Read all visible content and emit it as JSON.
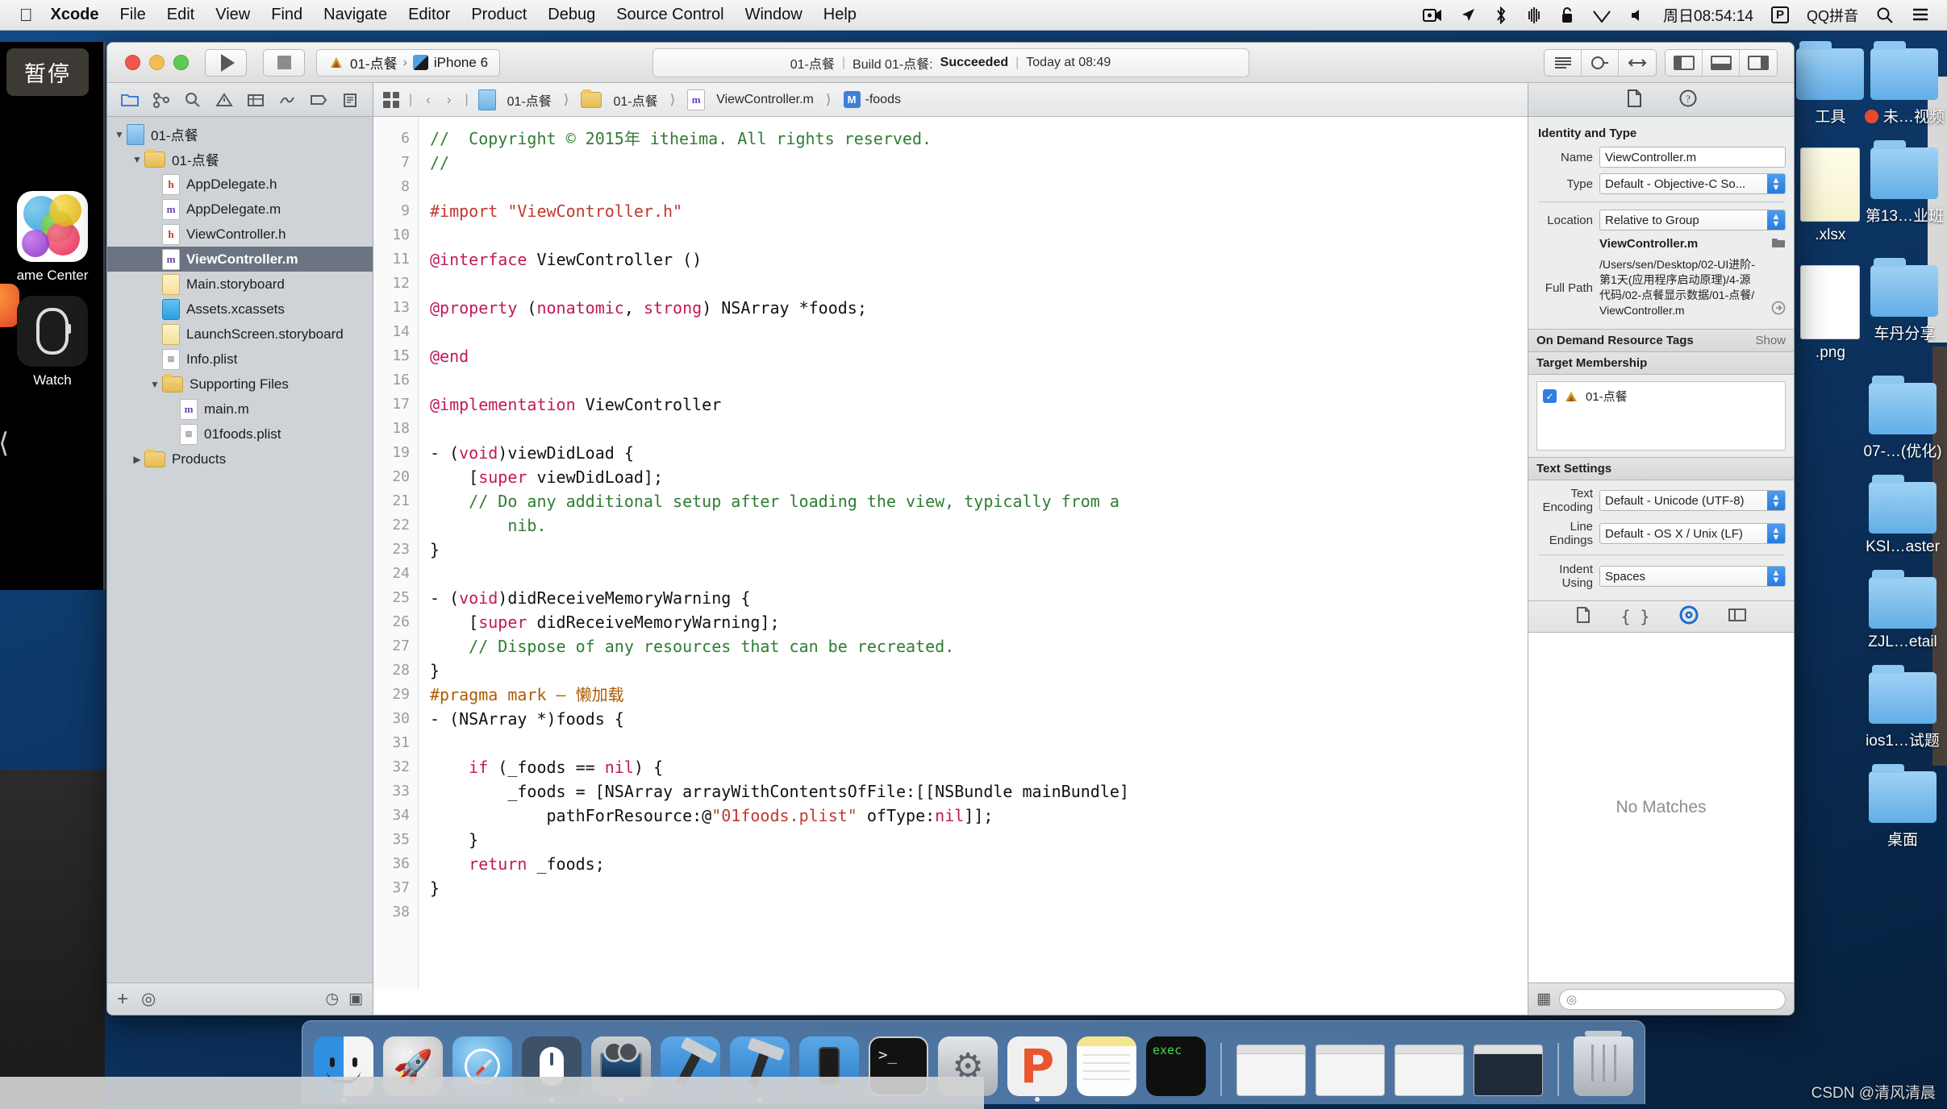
{
  "menubar": {
    "apple_icon": "apple-logo-icon",
    "items": [
      "Xcode",
      "File",
      "Edit",
      "View",
      "Find",
      "Navigate",
      "Editor",
      "Product",
      "Debug",
      "Source Control",
      "Window",
      "Help"
    ],
    "status_icons": [
      "screen-record-icon",
      "location-arrow-icon",
      "bluetooth-icon",
      "airdrop-icon",
      "lock-icon",
      "wifi-icon",
      "volume-icon"
    ],
    "clock": "周日08:54:14",
    "input_method_badge": "P",
    "input_method": "QQ拼音",
    "search_icon": "search-icon",
    "notification_icon": "notification-list-icon"
  },
  "tooltip": {
    "pause_label": "暂停"
  },
  "simulator": {
    "apps": [
      {
        "label": "ame Center",
        "icon": "game-center-icon"
      },
      {
        "label": "Watch",
        "icon": "watch-app-icon"
      }
    ]
  },
  "xcode": {
    "toolbar": {
      "run_icon": "run-play-icon",
      "stop_icon": "stop-square-icon",
      "scheme_target": "01-点餐",
      "scheme_chevron": "›",
      "scheme_device": "iPhone 6",
      "status": {
        "project": "01-点餐",
        "sep": "|",
        "build_text": "Build 01-点餐:",
        "result": "Succeeded",
        "time": "Today at 08:49"
      },
      "right_buttons": [
        "editor-standard-icon",
        "editor-assistant-icon",
        "editor-version-icon",
        "view-left-panel-icon",
        "view-bottom-panel-icon",
        "view-right-panel-icon"
      ]
    },
    "navigator": {
      "toolbar_icons": [
        "folder-navigator-icon",
        "source-control-icon",
        "search-navigator-icon",
        "issue-navigator-icon",
        "test-navigator-icon",
        "debug-navigator-icon",
        "breakpoint-navigator-icon",
        "report-navigator-icon"
      ],
      "tree": [
        {
          "label": "01-点餐",
          "icon": "project-icon",
          "indent": 0,
          "twisty": "▼",
          "selected": false
        },
        {
          "label": "01-点餐",
          "icon": "folder-icon",
          "indent": 1,
          "twisty": "▼",
          "selected": false
        },
        {
          "label": "AppDelegate.h",
          "icon": "header-file-icon",
          "indent": 2,
          "twisty": "",
          "selected": false
        },
        {
          "label": "AppDelegate.m",
          "icon": "objc-file-icon",
          "indent": 2,
          "twisty": "",
          "selected": false
        },
        {
          "label": "ViewController.h",
          "icon": "header-file-icon",
          "indent": 2,
          "twisty": "",
          "selected": false
        },
        {
          "label": "ViewController.m",
          "icon": "objc-file-icon",
          "indent": 2,
          "twisty": "",
          "selected": true
        },
        {
          "label": "Main.storyboard",
          "icon": "storyboard-icon",
          "indent": 2,
          "twisty": "",
          "selected": false
        },
        {
          "label": "Assets.xcassets",
          "icon": "xcassets-icon",
          "indent": 2,
          "twisty": "",
          "selected": false
        },
        {
          "label": "LaunchScreen.storyboard",
          "icon": "storyboard-icon",
          "indent": 2,
          "twisty": "",
          "selected": false
        },
        {
          "label": "Info.plist",
          "icon": "plist-file-icon",
          "indent": 2,
          "twisty": "",
          "selected": false
        },
        {
          "label": "Supporting Files",
          "icon": "folder-icon",
          "indent": 2,
          "twisty": "▼",
          "selected": false
        },
        {
          "label": "main.m",
          "icon": "objc-file-icon",
          "indent": 3,
          "twisty": "",
          "selected": false
        },
        {
          "label": "01foods.plist",
          "icon": "plist-file-icon",
          "indent": 3,
          "twisty": "",
          "selected": false
        },
        {
          "label": "Products",
          "icon": "folder-icon",
          "indent": 1,
          "twisty": "▶",
          "selected": false
        }
      ],
      "footer": {
        "add_icon": "plus-icon",
        "filter_icon": "filter-circle-icon",
        "recent_icon": "clock-icon",
        "source_icon": "source-control-filter-icon"
      }
    },
    "jumpbar": {
      "grid_icon": "related-items-icon",
      "back_icon": "‹",
      "forward_icon": "›",
      "crumbs": [
        {
          "label": "01-点餐",
          "icon": "project-icon"
        },
        {
          "label": "01-点餐",
          "icon": "folder-icon"
        },
        {
          "label": "ViewController.m",
          "icon": "objc-file-icon"
        },
        {
          "label": "-foods",
          "icon": "method-badge-icon"
        }
      ]
    },
    "code": {
      "first_line_number": 6,
      "lines": [
        {
          "n": "6",
          "tokens": [
            {
              "t": "//  Copyright © 2015年 itheima. All rights reserved.",
              "c": "cm"
            }
          ]
        },
        {
          "n": "7",
          "tokens": [
            {
              "t": "//",
              "c": "cm"
            }
          ]
        },
        {
          "n": "8",
          "tokens": []
        },
        {
          "n": "9",
          "tokens": [
            {
              "t": "#import ",
              "c": "pp"
            },
            {
              "t": "\"ViewController.h\"",
              "c": "str"
            }
          ]
        },
        {
          "n": "10",
          "tokens": []
        },
        {
          "n": "11",
          "tokens": [
            {
              "t": "@interface",
              "c": "kw"
            },
            {
              "t": " ViewController ()",
              "c": ""
            }
          ]
        },
        {
          "n": "12",
          "tokens": []
        },
        {
          "n": "13",
          "tokens": [
            {
              "t": "@property",
              "c": "kw"
            },
            {
              "t": " (",
              "c": ""
            },
            {
              "t": "nonatomic",
              "c": "kw"
            },
            {
              "t": ", ",
              "c": ""
            },
            {
              "t": "strong",
              "c": "kw"
            },
            {
              "t": ") NSArray *foods;",
              "c": ""
            }
          ]
        },
        {
          "n": "14",
          "tokens": []
        },
        {
          "n": "15",
          "tokens": [
            {
              "t": "@end",
              "c": "kw"
            }
          ]
        },
        {
          "n": "16",
          "tokens": []
        },
        {
          "n": "17",
          "tokens": [
            {
              "t": "@implementation",
              "c": "kw"
            },
            {
              "t": " ViewController",
              "c": ""
            }
          ]
        },
        {
          "n": "18",
          "tokens": []
        },
        {
          "n": "19",
          "tokens": [
            {
              "t": "- (",
              "c": ""
            },
            {
              "t": "void",
              "c": "kw"
            },
            {
              "t": ")viewDidLoad {",
              "c": ""
            }
          ]
        },
        {
          "n": "20",
          "tokens": [
            {
              "t": "    [",
              "c": ""
            },
            {
              "t": "super",
              "c": "kw"
            },
            {
              "t": " viewDidLoad];",
              "c": ""
            }
          ]
        },
        {
          "n": "21",
          "tokens": [
            {
              "t": "    // Do any additional setup after loading the view, typically from a",
              "c": "cm"
            }
          ]
        },
        {
          "n": "",
          "tokens": [
            {
              "t": "        nib.",
              "c": "cm"
            }
          ]
        },
        {
          "n": "22",
          "tokens": [
            {
              "t": "}",
              "c": ""
            }
          ]
        },
        {
          "n": "23",
          "tokens": []
        },
        {
          "n": "24",
          "tokens": [
            {
              "t": "- (",
              "c": ""
            },
            {
              "t": "void",
              "c": "kw"
            },
            {
              "t": ")didReceiveMemoryWarning {",
              "c": ""
            }
          ]
        },
        {
          "n": "25",
          "tokens": [
            {
              "t": "    [",
              "c": ""
            },
            {
              "t": "super",
              "c": "kw"
            },
            {
              "t": " didReceiveMemoryWarning];",
              "c": ""
            }
          ]
        },
        {
          "n": "26",
          "tokens": [
            {
              "t": "    // Dispose of any resources that can be recreated.",
              "c": "cm"
            }
          ]
        },
        {
          "n": "27",
          "tokens": [
            {
              "t": "}",
              "c": ""
            }
          ]
        },
        {
          "n": "28",
          "tokens": [
            {
              "t": "#pragma mark – 懒加载",
              "c": "prag"
            }
          ]
        },
        {
          "n": "29",
          "tokens": [
            {
              "t": "- (NSArray *)foods {",
              "c": ""
            }
          ]
        },
        {
          "n": "30",
          "tokens": []
        },
        {
          "n": "31",
          "tokens": [
            {
              "t": "    ",
              "c": ""
            },
            {
              "t": "if",
              "c": "kw"
            },
            {
              "t": " (_foods == ",
              "c": ""
            },
            {
              "t": "nil",
              "c": "kw"
            },
            {
              "t": ") {",
              "c": ""
            }
          ]
        },
        {
          "n": "32",
          "tokens": [
            {
              "t": "        _foods = [NSArray arrayWithContentsOfFile:[[NSBundle mainBundle]",
              "c": ""
            }
          ]
        },
        {
          "n": "",
          "tokens": [
            {
              "t": "            pathForResource:@",
              "c": ""
            },
            {
              "t": "\"01foods.plist\"",
              "c": "str"
            },
            {
              "t": " ofType:",
              "c": ""
            },
            {
              "t": "nil",
              "c": "kw"
            },
            {
              "t": "]];",
              "c": ""
            }
          ]
        },
        {
          "n": "33",
          "tokens": [
            {
              "t": "    }",
              "c": ""
            }
          ]
        },
        {
          "n": "34",
          "tokens": [
            {
              "t": "    ",
              "c": ""
            },
            {
              "t": "return",
              "c": "kw"
            },
            {
              "t": " _foods;",
              "c": ""
            }
          ]
        },
        {
          "n": "35",
          "tokens": [
            {
              "t": "}",
              "c": ""
            }
          ]
        },
        {
          "n": "36",
          "tokens": []
        },
        {
          "n": "37",
          "tokens": []
        },
        {
          "n": "38",
          "tokens": []
        }
      ]
    },
    "inspector": {
      "toolbar_icons": [
        "file-inspector-icon",
        "quick-help-icon"
      ],
      "identity": {
        "title": "Identity and Type",
        "name_label": "Name",
        "name_value": "ViewController.m",
        "type_label": "Type",
        "type_value": "Default - Objective-C So...",
        "location_label": "Location",
        "location_value": "Relative to Group",
        "location_file": "ViewController.m",
        "folder_icon": "folder-browse-icon",
        "fullpath_label": "Full Path",
        "fullpath_value": "/Users/sen/Desktop/02-UI进阶-第1天(应用程序启动原理)/4-源代码/02-点餐显示数据/01-点餐/ViewController.m",
        "reveal_icon": "reveal-arrow-icon"
      },
      "ondemand": {
        "title": "On Demand Resource Tags",
        "show_label": "Show"
      },
      "target_membership": {
        "title": "Target Membership",
        "targets": [
          {
            "label": "01-点餐",
            "checked": true,
            "icon": "app-target-icon"
          }
        ]
      },
      "text_settings": {
        "title": "Text Settings",
        "encoding_label": "Text Encoding",
        "encoding_value": "Default - Unicode (UTF-8)",
        "line_endings_label": "Line Endings",
        "line_endings_value": "Default - OS X / Unix (LF)",
        "indent_label": "Indent Using",
        "indent_value": "Spaces"
      },
      "library": {
        "tabs": [
          "file-template-library-icon",
          "code-snippet-library-icon",
          "object-library-icon",
          "media-library-icon"
        ],
        "selected_tab_index": 2,
        "empty_message": "No Matches",
        "footer_filter_placeholder": "",
        "footer_icons": [
          "grid-view-icon",
          "filter-circle-icon"
        ]
      }
    }
  },
  "desktop": {
    "icons": [
      {
        "label": "工具",
        "type": "folder"
      },
      {
        "label": "未…视频",
        "type": "folder",
        "badge": "red-dot"
      },
      {
        "label": ".xlsx",
        "type": "file-xlsx"
      },
      {
        "label": "第13…业班",
        "type": "folder"
      },
      {
        "label": ".png",
        "type": "file-png"
      },
      {
        "label": "车丹分享",
        "type": "folder"
      },
      {
        "label": "07-…(优化)",
        "type": "folder"
      },
      {
        "label": "KSI…aster",
        "type": "folder"
      },
      {
        "label": "ZJL…etail",
        "type": "folder"
      },
      {
        "label": "ios1…试题",
        "type": "folder"
      },
      {
        "label": "桌面",
        "type": "folder"
      }
    ]
  },
  "dock": {
    "apps": [
      {
        "name": "finder-icon",
        "running": true
      },
      {
        "name": "launchpad-icon",
        "running": false
      },
      {
        "name": "safari-icon",
        "running": false
      },
      {
        "name": "mouse-utility-icon",
        "running": true
      },
      {
        "name": "screen-recorder-icon",
        "running": true
      },
      {
        "name": "xcode-icon",
        "running": false
      },
      {
        "name": "xcode-beta-icon",
        "running": true
      },
      {
        "name": "ios-simulator-icon",
        "running": false
      },
      {
        "name": "terminal-icon",
        "running": false
      },
      {
        "name": "system-preferences-icon",
        "running": false
      },
      {
        "name": "p-app-icon",
        "running": true
      },
      {
        "name": "notes-icon",
        "running": true
      },
      {
        "name": "exec-terminal-icon",
        "running": false
      }
    ],
    "windows": [
      {
        "name": "window-thumb-document"
      },
      {
        "name": "window-thumb-document-2"
      },
      {
        "name": "window-thumb-browser"
      },
      {
        "name": "window-thumb-code"
      }
    ],
    "trash": {
      "name": "trash-icon"
    }
  },
  "watermark": "CSDN @清风清晨"
}
